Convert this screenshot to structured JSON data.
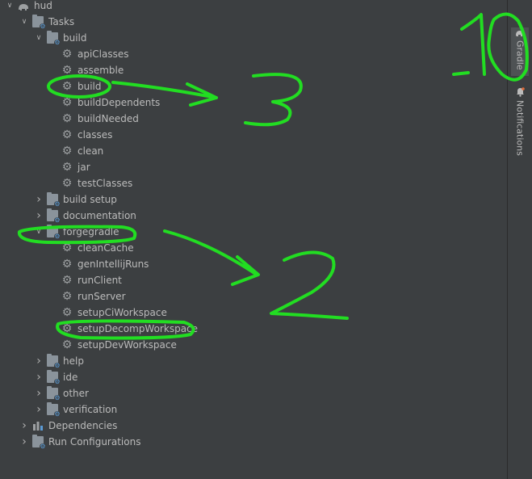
{
  "tree": {
    "rows": [
      {
        "label": "hud",
        "depth": 0,
        "icon": "elephant-icon",
        "expanded": true
      },
      {
        "label": "Tasks",
        "depth": 1,
        "icon": "folder-cog-icon",
        "expanded": true
      },
      {
        "label": "build",
        "depth": 2,
        "icon": "folder-cog-icon",
        "expanded": true
      },
      {
        "label": "apiClasses",
        "depth": 3,
        "icon": "gear-icon"
      },
      {
        "label": "assemble",
        "depth": 3,
        "icon": "gear-icon"
      },
      {
        "label": "build",
        "depth": 3,
        "icon": "gear-icon"
      },
      {
        "label": "buildDependents",
        "depth": 3,
        "icon": "gear-icon"
      },
      {
        "label": "buildNeeded",
        "depth": 3,
        "icon": "gear-icon"
      },
      {
        "label": "classes",
        "depth": 3,
        "icon": "gear-icon"
      },
      {
        "label": "clean",
        "depth": 3,
        "icon": "gear-icon"
      },
      {
        "label": "jar",
        "depth": 3,
        "icon": "gear-icon"
      },
      {
        "label": "testClasses",
        "depth": 3,
        "icon": "gear-icon"
      },
      {
        "label": "build setup",
        "depth": 2,
        "icon": "folder-cog-icon",
        "expanded": false
      },
      {
        "label": "documentation",
        "depth": 2,
        "icon": "folder-cog-icon",
        "expanded": false
      },
      {
        "label": "forgegradle",
        "depth": 2,
        "icon": "folder-cog-icon",
        "expanded": true
      },
      {
        "label": "cleanCache",
        "depth": 3,
        "icon": "gear-icon"
      },
      {
        "label": "genIntellijRuns",
        "depth": 3,
        "icon": "gear-icon"
      },
      {
        "label": "runClient",
        "depth": 3,
        "icon": "gear-icon"
      },
      {
        "label": "runServer",
        "depth": 3,
        "icon": "gear-icon"
      },
      {
        "label": "setupCiWorkspace",
        "depth": 3,
        "icon": "gear-icon"
      },
      {
        "label": "setupDecompWorkspace",
        "depth": 3,
        "icon": "gear-icon"
      },
      {
        "label": "setupDevWorkspace",
        "depth": 3,
        "icon": "gear-icon"
      },
      {
        "label": "help",
        "depth": 2,
        "icon": "folder-cog-icon",
        "expanded": false
      },
      {
        "label": "ide",
        "depth": 2,
        "icon": "folder-cog-icon",
        "expanded": false
      },
      {
        "label": "other",
        "depth": 2,
        "icon": "folder-cog-icon",
        "expanded": false
      },
      {
        "label": "verification",
        "depth": 2,
        "icon": "folder-cog-icon",
        "expanded": false
      },
      {
        "label": "Dependencies",
        "depth": 1,
        "icon": "dependencies-icon",
        "expanded": false
      },
      {
        "label": "Run Configurations",
        "depth": 1,
        "icon": "folder-cog-icon",
        "expanded": false
      }
    ]
  },
  "sidebar": {
    "gradle_label": "Gradle",
    "notifications_label": "Notifications"
  },
  "annotations": {
    "color": "#22dd22",
    "numbers": [
      "1",
      "0",
      "3",
      "2"
    ]
  },
  "colors": {
    "background": "#3c3f41",
    "text": "#bbbbbb",
    "icon": "#9da0a2",
    "annotation": "#22dd22"
  }
}
